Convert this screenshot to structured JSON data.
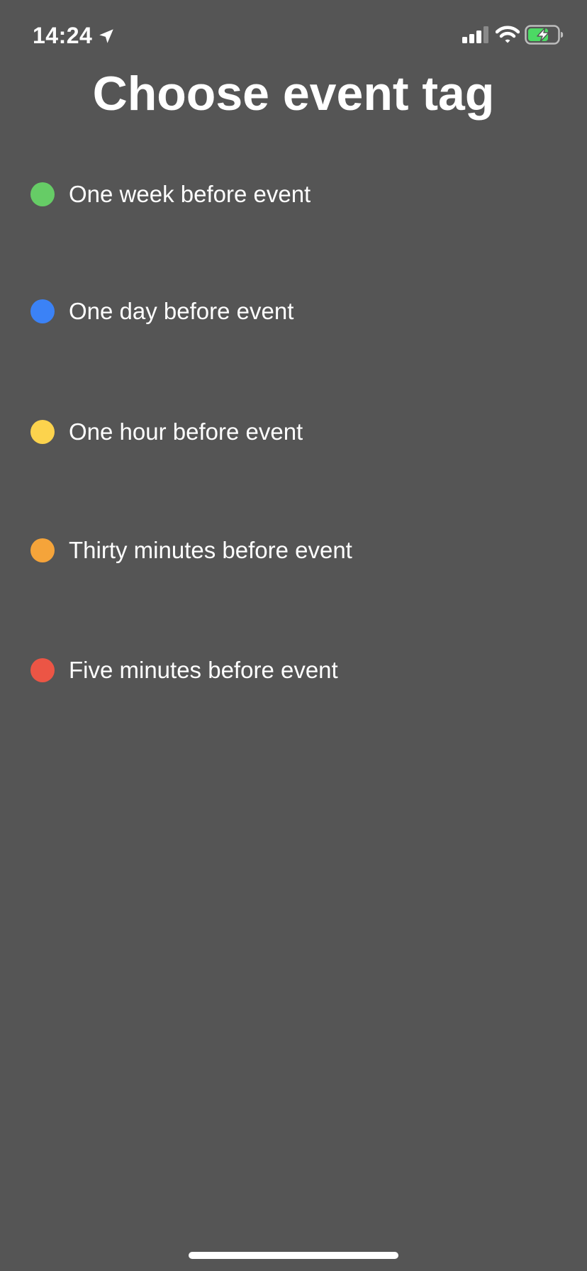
{
  "status_bar": {
    "time": "14:24",
    "location_icon": "location-arrow-icon",
    "signal_icon": "cellular-signal-icon",
    "wifi_icon": "wifi-icon",
    "battery_icon": "battery-charging-icon",
    "battery_color": "#4cd964"
  },
  "title": "Choose event tag",
  "tags": [
    {
      "label": "One week before event",
      "color": "#66cc66"
    },
    {
      "label": "One day before event",
      "color": "#3b82f6"
    },
    {
      "label": "One hour before event",
      "color": "#fcd34d"
    },
    {
      "label": "Thirty minutes before event",
      "color": "#f5a43a"
    },
    {
      "label": "Five minutes before event",
      "color": "#ec5545"
    }
  ],
  "colors": {
    "background": "#555555",
    "text": "#ffffff"
  }
}
